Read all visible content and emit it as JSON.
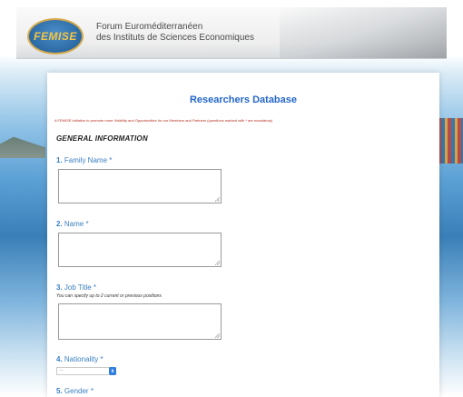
{
  "header": {
    "logo_text": "FEMISE",
    "forum_line1": "Forum Euroméditerranéen",
    "forum_line2": "des Instituts de Sciences Economiques"
  },
  "form": {
    "title": "Researchers Database",
    "intro": "A FEMISE initiative to promote more Visibility and Opportunities for our Members and Partners (questions marked with * are mandatory)",
    "section_title": "GENERAL INFORMATION",
    "questions": [
      {
        "num": "1.",
        "label": "Family Name *",
        "value": ""
      },
      {
        "num": "2.",
        "label": "Name *",
        "value": ""
      },
      {
        "num": "3.",
        "label": "Job Title *",
        "hint": "You can specify up to 2 current or previous positions",
        "value": ""
      },
      {
        "num": "4.",
        "label": "Nationality *",
        "selected": "--"
      },
      {
        "num": "5.",
        "label": "Gender *"
      }
    ]
  },
  "colors": {
    "accent": "#2466c8",
    "label": "#3a7fc2",
    "intro": "#b5301f"
  },
  "icons": {
    "select_arrow": "updown-arrow-icon"
  }
}
